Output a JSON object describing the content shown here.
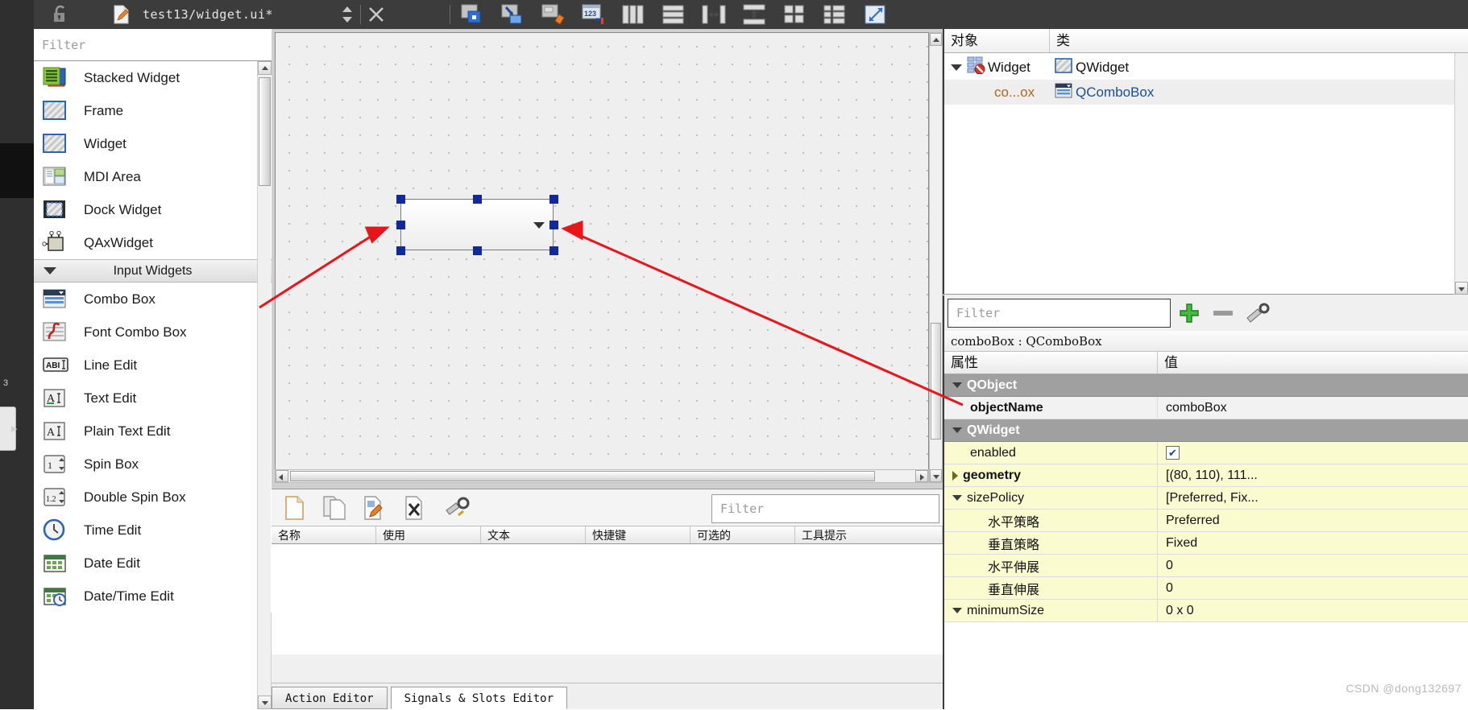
{
  "titlebar": {
    "filename": "test13/widget.ui*",
    "icons": [
      {
        "name": "lock-open-icon"
      },
      {
        "name": "edit-document-icon"
      },
      {
        "name": "up-down-arrows-icon"
      },
      {
        "name": "close-icon"
      },
      {
        "name": "edit-widgets-icon"
      },
      {
        "name": "edit-signals-slots-icon"
      },
      {
        "name": "edit-buddies-icon"
      },
      {
        "name": "edit-tab-order-icon"
      },
      {
        "name": "layout-horizontally-icon"
      },
      {
        "name": "layout-vertically-icon"
      },
      {
        "name": "layout-horizontal-splitter-icon"
      },
      {
        "name": "layout-vertical-splitter-icon"
      },
      {
        "name": "layout-grid-icon"
      },
      {
        "name": "layout-form-icon"
      },
      {
        "name": "adjust-size-icon"
      },
      {
        "name": "break-layout-icon"
      }
    ]
  },
  "widget_box": {
    "filter_placeholder": "Filter",
    "items": [
      {
        "label": "Stacked Widget",
        "icon": "stacked-widget-icon",
        "type": "item"
      },
      {
        "label": "Frame",
        "icon": "frame-icon",
        "type": "item"
      },
      {
        "label": "Widget",
        "icon": "widget-icon",
        "type": "item"
      },
      {
        "label": "MDI Area",
        "icon": "mdi-area-icon",
        "type": "item"
      },
      {
        "label": "Dock Widget",
        "icon": "dock-widget-icon",
        "type": "item"
      },
      {
        "label": "QAxWidget",
        "icon": "qaxwidget-icon",
        "type": "item"
      },
      {
        "label": "Input Widgets",
        "icon": "collapse-triangle-icon",
        "type": "category"
      },
      {
        "label": "Combo Box",
        "icon": "combo-box-icon",
        "type": "item"
      },
      {
        "label": "Font Combo Box",
        "icon": "font-combo-box-icon",
        "type": "item"
      },
      {
        "label": "Line Edit",
        "icon": "line-edit-icon",
        "type": "item"
      },
      {
        "label": "Text Edit",
        "icon": "text-edit-icon",
        "type": "item"
      },
      {
        "label": "Plain Text Edit",
        "icon": "plain-text-edit-icon",
        "type": "item"
      },
      {
        "label": "Spin Box",
        "icon": "spin-box-icon",
        "type": "item"
      },
      {
        "label": "Double Spin Box",
        "icon": "double-spin-box-icon",
        "type": "item"
      },
      {
        "label": "Time Edit",
        "icon": "time-edit-icon",
        "type": "item"
      },
      {
        "label": "Date Edit",
        "icon": "date-edit-icon",
        "type": "item"
      },
      {
        "label": "Date/Time Edit",
        "icon": "date-time-edit-icon",
        "type": "item"
      }
    ]
  },
  "form_editor": {
    "selected_widget": "comboBox",
    "selection_handle_color": "#11299b"
  },
  "action_editor": {
    "filter_placeholder": "Filter",
    "toolbar_icons": [
      {
        "name": "new-action-icon"
      },
      {
        "name": "copy-action-icon"
      },
      {
        "name": "edit-action-icon"
      },
      {
        "name": "delete-action-icon"
      },
      {
        "name": "configure-action-icon"
      }
    ],
    "columns": [
      "名称",
      "使用",
      "文本",
      "快捷键",
      "可选的",
      "工具提示"
    ],
    "rows": [],
    "tabs": [
      {
        "label": "Action Editor",
        "selected": false
      },
      {
        "label": "Signals & Slots Editor",
        "selected": true
      }
    ]
  },
  "object_inspector": {
    "columns": [
      "对象",
      "类"
    ],
    "rows": [
      {
        "name": "Widget",
        "class": "QWidget",
        "icon": "widget-no-layout-icon",
        "class_icon": "widget-icon",
        "expanded": true,
        "depth": 0
      },
      {
        "name": "co...ox",
        "class": "QComboBox",
        "icon": "",
        "class_icon": "combo-box-icon",
        "expanded": false,
        "depth": 1
      }
    ]
  },
  "property_editor": {
    "filter_placeholder": "Filter",
    "toolbar_icons": [
      {
        "name": "add-dynamic-property-icon"
      },
      {
        "name": "remove-dynamic-property-icon"
      },
      {
        "name": "configure-property-editor-icon"
      }
    ],
    "object_header": "comboBox : QComboBox",
    "columns": [
      "属性",
      "值"
    ],
    "rows": [
      {
        "key": "QObject",
        "value": "",
        "kind": "group",
        "expanded": true
      },
      {
        "key": "objectName",
        "value": "comboBox",
        "kind": "grey",
        "bold": true,
        "indent": true
      },
      {
        "key": "QWidget",
        "value": "",
        "kind": "group",
        "expanded": true
      },
      {
        "key": "enabled",
        "value": "",
        "kind": "yellow",
        "indent": true,
        "checkbox": true,
        "checked": true
      },
      {
        "key": "geometry",
        "value": "[(80, 110), 111...",
        "kind": "yellow",
        "bold": true,
        "expandable": true
      },
      {
        "key": "sizePolicy",
        "value": "[Preferred, Fix...",
        "kind": "yellow",
        "expandable": true,
        "expanded": true
      },
      {
        "key": "水平策略",
        "value": "Preferred",
        "kind": "yellow",
        "indent2": true
      },
      {
        "key": "垂直策略",
        "value": "Fixed",
        "kind": "yellow",
        "indent2": true
      },
      {
        "key": "水平伸展",
        "value": "0",
        "kind": "yellow",
        "indent2": true
      },
      {
        "key": "垂直伸展",
        "value": "0",
        "kind": "yellow",
        "indent2": true
      },
      {
        "key": "minimumSize",
        "value": "0 x 0",
        "kind": "yellow",
        "expandable": true
      }
    ]
  },
  "watermark": "CSDN @dong132697",
  "colors": {
    "titlebar_bg": "#3c3c3c",
    "form_bg": "#efefef",
    "selection": "#11299b",
    "group_row": "#a0a0a0",
    "property_yellow": "#fbfbd0",
    "annotation_red": "#e8151a"
  }
}
